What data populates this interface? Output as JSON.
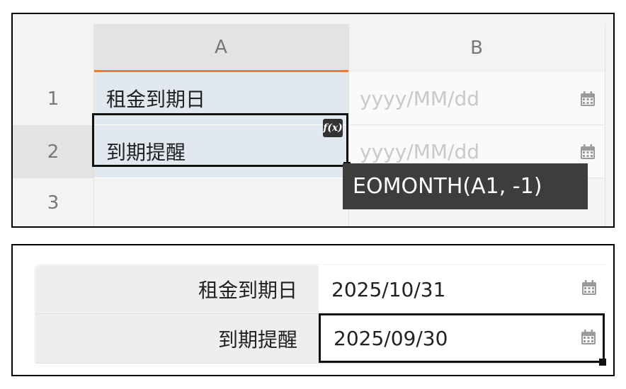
{
  "spreadsheet": {
    "columns": [
      "A",
      "B"
    ],
    "rows": [
      "1",
      "2",
      "3"
    ],
    "cells": {
      "a1": "租金到期日",
      "a2": "到期提醒",
      "b1_placeholder": "yyyy/MM/dd",
      "b2_placeholder": "yyyy/MM/dd"
    },
    "formula_badge": "f(x)",
    "formula_tooltip": "EOMONTH(A1, -1)",
    "icons": {
      "date_picker": "calendar-icon",
      "formula": "function-icon"
    },
    "colors": {
      "active_column_accent": "#f07a2a",
      "tooltip_bg": "#3d3d3d",
      "cell_fill": "#e2e8f0"
    }
  },
  "form": {
    "fields": [
      {
        "label": "租金到期日",
        "value": "2025/10/31"
      },
      {
        "label": "到期提醒",
        "value": "2025/09/30"
      }
    ]
  }
}
